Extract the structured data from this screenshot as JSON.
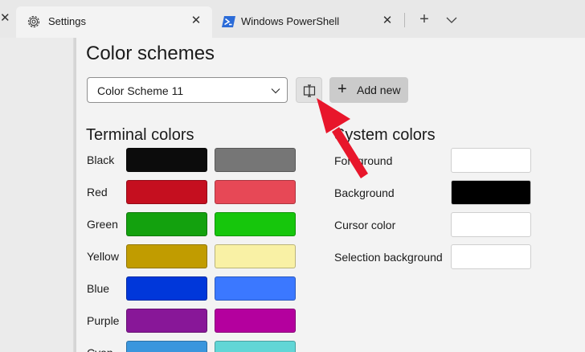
{
  "tabs": [
    {
      "label": "Settings",
      "icon": "gear-icon",
      "active": true,
      "close": "✕"
    },
    {
      "label": "Windows PowerShell",
      "icon": "powershell-icon",
      "active": false,
      "close": "✕"
    }
  ],
  "tabbar": {
    "new_tab": "+",
    "stub_close": "✕"
  },
  "page": {
    "title": "Color schemes"
  },
  "scheme_selector": {
    "value": "Color Scheme 11"
  },
  "buttons": {
    "rename_icon": "rename-icon",
    "add_new": "Add new",
    "add_new_glyph": "+"
  },
  "terminal_colors": {
    "title": "Terminal colors",
    "rows": [
      {
        "label": "Black",
        "normal": "#0c0c0c",
        "bright": "#767676"
      },
      {
        "label": "Red",
        "normal": "#c50f1f",
        "bright": "#e74856"
      },
      {
        "label": "Green",
        "normal": "#13a10e",
        "bright": "#16c60c"
      },
      {
        "label": "Yellow",
        "normal": "#c19c00",
        "bright": "#f9f1a5"
      },
      {
        "label": "Blue",
        "normal": "#0037da",
        "bright": "#3b78ff"
      },
      {
        "label": "Purple",
        "normal": "#881798",
        "bright": "#b4009e"
      },
      {
        "label": "Cyan",
        "normal": "#3a96dd",
        "bright": "#61d6d6"
      }
    ]
  },
  "system_colors": {
    "title": "System colors",
    "rows": [
      {
        "label": "Foreground",
        "color": "#ffffff"
      },
      {
        "label": "Background",
        "color": "#000000"
      },
      {
        "label": "Cursor color",
        "color": "#ffffff"
      },
      {
        "label": "Selection background",
        "color": "#ffffff"
      }
    ]
  },
  "colors": {
    "annotation_arrow": "#e8162b"
  }
}
